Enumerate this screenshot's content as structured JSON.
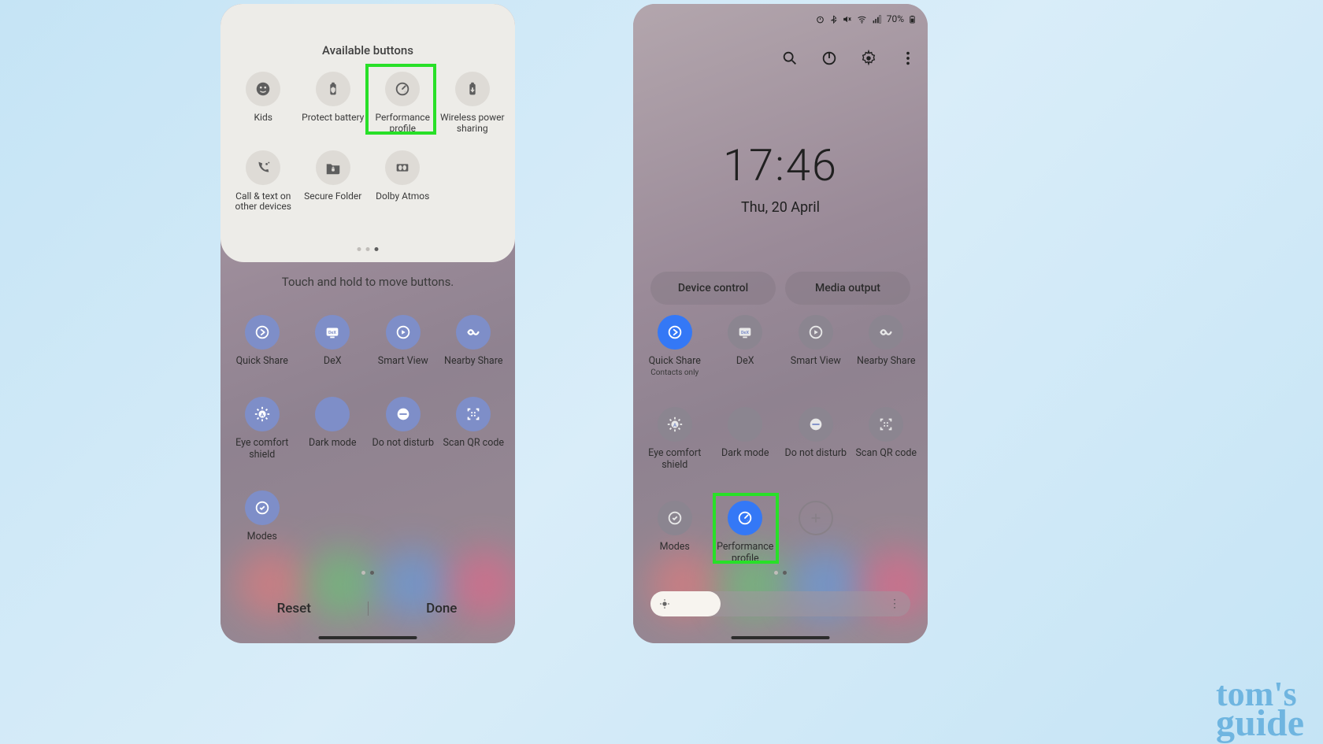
{
  "left": {
    "availableTitle": "Available buttons",
    "available": [
      {
        "label": "Kids",
        "icon": "kids"
      },
      {
        "label": "Protect battery",
        "icon": "battery-shield"
      },
      {
        "label": "Performance profile",
        "icon": "gauge",
        "highlight": true
      },
      {
        "label": "Wireless power sharing",
        "icon": "battery-share"
      },
      {
        "label": "Call & text on other devices",
        "icon": "call-text"
      },
      {
        "label": "Secure Folder",
        "icon": "secure-folder"
      },
      {
        "label": "Dolby Atmos",
        "icon": "dolby"
      }
    ],
    "hint": "Touch and hold to move buttons.",
    "qs": [
      {
        "label": "Quick Share",
        "icon": "quick-share",
        "style": "blue"
      },
      {
        "label": "DeX",
        "icon": "dex",
        "style": "blue"
      },
      {
        "label": "Smart View",
        "icon": "smart-view",
        "style": "blue"
      },
      {
        "label": "Nearby Share",
        "icon": "nearby",
        "style": "blue"
      },
      {
        "label": "Eye comfort shield",
        "icon": "eye-comfort",
        "style": "blue"
      },
      {
        "label": "Dark mode",
        "icon": "moon",
        "style": "blue"
      },
      {
        "label": "Do not disturb",
        "icon": "dnd",
        "style": "blue"
      },
      {
        "label": "Scan QR code",
        "icon": "qr",
        "style": "blue"
      },
      {
        "label": "Modes",
        "icon": "modes",
        "style": "blue"
      }
    ],
    "reset": "Reset",
    "done": "Done"
  },
  "right": {
    "status": {
      "battery_pct": "70%"
    },
    "clock": {
      "time": "17:46",
      "date": "Thu, 20 April"
    },
    "pills": {
      "device_control": "Device control",
      "media_output": "Media output"
    },
    "qs": [
      {
        "label": "Quick Share",
        "sub": "Contacts only",
        "icon": "quick-share",
        "style": "bright"
      },
      {
        "label": "DeX",
        "icon": "dex",
        "style": "grey"
      },
      {
        "label": "Smart View",
        "icon": "smart-view",
        "style": "grey"
      },
      {
        "label": "Nearby Share",
        "icon": "nearby",
        "style": "grey"
      },
      {
        "label": "Eye comfort shield",
        "icon": "eye-comfort",
        "style": "grey"
      },
      {
        "label": "Dark mode",
        "icon": "moon",
        "style": "grey"
      },
      {
        "label": "Do not disturb",
        "icon": "dnd",
        "style": "grey"
      },
      {
        "label": "Scan QR code",
        "icon": "qr",
        "style": "grey"
      },
      {
        "label": "Modes",
        "icon": "modes",
        "style": "grey"
      },
      {
        "label": "Performance profile",
        "icon": "gauge",
        "style": "bright",
        "highlight": true
      },
      {
        "label": "",
        "icon": "plus",
        "style": "add"
      }
    ]
  },
  "watermark": {
    "top": "tom's",
    "bot": "guide"
  }
}
